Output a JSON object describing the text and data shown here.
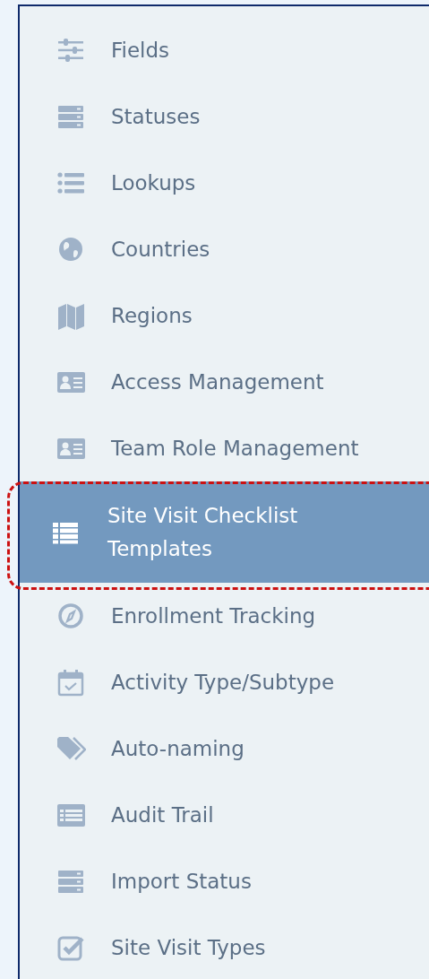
{
  "sidebar": {
    "items": [
      {
        "label": "Fields",
        "selected": false,
        "annotated": false
      },
      {
        "label": "Statuses",
        "selected": false,
        "annotated": false
      },
      {
        "label": "Lookups",
        "selected": false,
        "annotated": false
      },
      {
        "label": "Countries",
        "selected": false,
        "annotated": false
      },
      {
        "label": "Regions",
        "selected": false,
        "annotated": false
      },
      {
        "label": "Access Management",
        "selected": false,
        "annotated": false
      },
      {
        "label": "Team Role Management",
        "selected": false,
        "annotated": false
      },
      {
        "label": "Site Visit Checklist Templates",
        "selected": true,
        "annotated": true
      },
      {
        "label": "Enrollment Tracking",
        "selected": false,
        "annotated": false
      },
      {
        "label": "Activity Type/Subtype",
        "selected": false,
        "annotated": false
      },
      {
        "label": "Auto-naming",
        "selected": false,
        "annotated": false
      },
      {
        "label": "Audit Trail",
        "selected": false,
        "annotated": false
      },
      {
        "label": "Import Status",
        "selected": false,
        "annotated": false
      },
      {
        "label": "Site Visit Types",
        "selected": false,
        "annotated": false
      }
    ]
  }
}
